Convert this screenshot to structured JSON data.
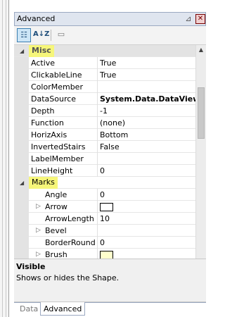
{
  "window": {
    "title": "Advanced",
    "close_glyph": "✕",
    "pin_glyph": "⊿"
  },
  "toolbar": {
    "categorized_glyph": "☷",
    "alphabetical_glyph": "A↓Z",
    "pages_glyph": "▭"
  },
  "grid": {
    "categories": [
      {
        "label": "Misc",
        "expander": "◢",
        "properties": [
          {
            "name": "Active",
            "value": "True"
          },
          {
            "name": "ClickableLine",
            "value": "True"
          },
          {
            "name": "ColorMember",
            "value": ""
          },
          {
            "name": "DataSource",
            "value": "System.Data.DataView"
          },
          {
            "name": "Depth",
            "value": "-1"
          },
          {
            "name": "Function",
            "value": "(none)"
          },
          {
            "name": "HorizAxis",
            "value": "Bottom"
          },
          {
            "name": "InvertedStairs",
            "value": "False"
          },
          {
            "name": "LabelMember",
            "value": ""
          },
          {
            "name": "LineHeight",
            "value": "0"
          }
        ]
      },
      {
        "label": "Marks",
        "expander": "◢",
        "properties": [
          {
            "name": "Angle",
            "value": "0"
          },
          {
            "name": "Arrow",
            "value": ""
          },
          {
            "name": "ArrowLength",
            "value": "10"
          },
          {
            "name": "Bevel",
            "value": ""
          },
          {
            "name": "BorderRound",
            "value": "0"
          },
          {
            "name": "Brush",
            "value": ""
          }
        ]
      }
    ],
    "sub_expander_glyph": "▷",
    "arrow_swatch_color": "#ffffff",
    "brush_swatch_color": "#ffffcc"
  },
  "scrollbar": {
    "up_glyph": "▲",
    "down_glyph": "▼"
  },
  "description": {
    "title": "Visible",
    "text": "Shows or hides the Shape."
  },
  "tabs": [
    {
      "label": "Data"
    },
    {
      "label": "Advanced"
    }
  ]
}
